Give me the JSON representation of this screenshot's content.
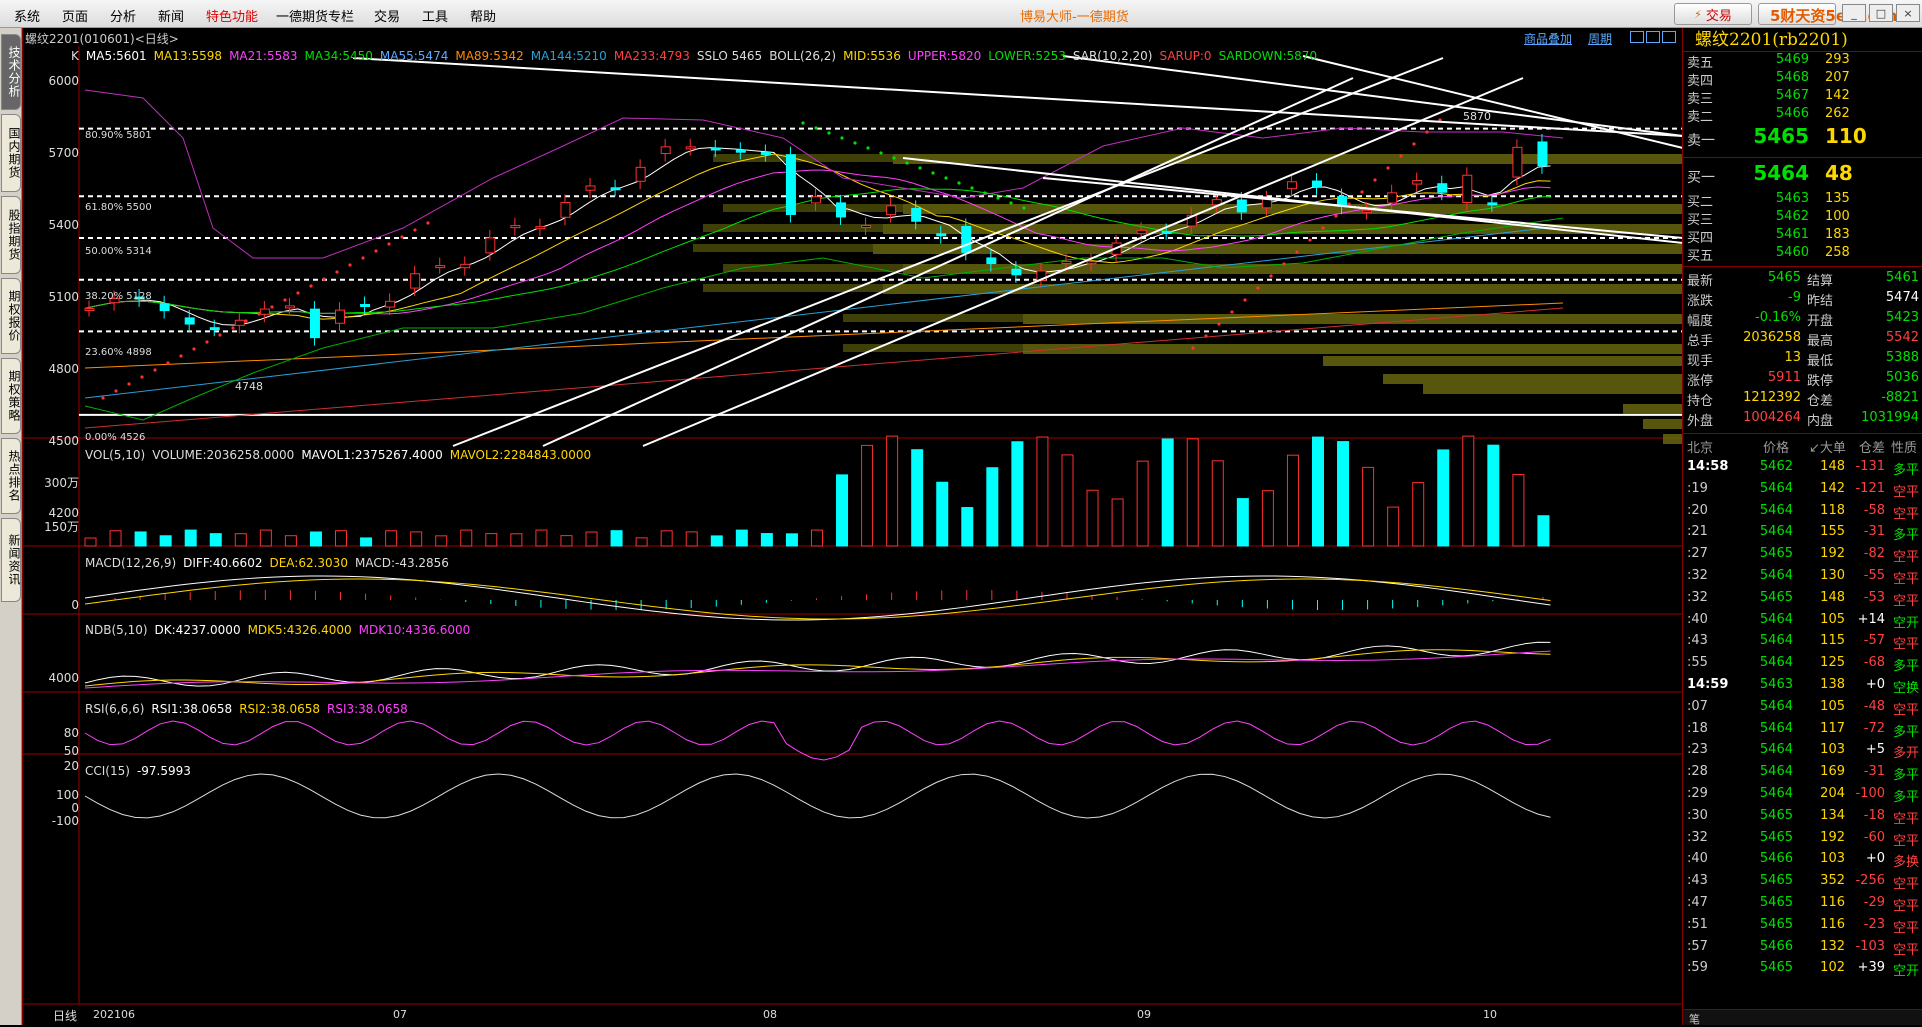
{
  "menu": [
    "系统",
    "页面",
    "分析",
    "新闻",
    "特色功能",
    "一德期货专栏",
    "交易",
    "工具",
    "帮助"
  ],
  "app_title": "博易大师-一德期货",
  "trade_button": "交易",
  "watermark": "5财天资5etz.com",
  "side_tabs": [
    "技术分析",
    "国内期货",
    "股指期货",
    "期权报价",
    "期权策略",
    "热点排名",
    "新闻资讯"
  ],
  "chart": {
    "header": "螺纹2201(010601)<日线>",
    "links": [
      "商品叠加",
      "周期"
    ],
    "k_line": [
      "K",
      "MA5:5601",
      "MA13:5598",
      "MA21:5583",
      "MA34:5450",
      "MA55:5474",
      "MA89:5342",
      "MA144:5210",
      "MA233:4793",
      "SSLO 5465",
      "BOLL(26,2)",
      "MID:5536",
      "UPPER:5820",
      "LOWER:5253",
      "SAR(10,2,20)",
      "SARUP:0",
      "SARDOWN:5870"
    ],
    "k_colors": [
      "#ddd",
      "#fff",
      "#ffd700",
      "#ff40ff",
      "#00e000",
      "#5aa9ff",
      "#ff8c00",
      "#2a9fd6",
      "#ff4040",
      "#ddd",
      "#ddd",
      "#ffd700",
      "#ff40ff",
      "#00e000",
      "#ddd",
      "#ff4040",
      "#00e000"
    ],
    "fib_labels": [
      "80.90% 5801",
      "61.80% 5500",
      "50.00% 5314",
      "38.20% 5128",
      "23.60% 4898",
      "0.00% 4526"
    ],
    "price_axis": [
      "6000",
      "5700",
      "5400",
      "5100",
      "4800",
      "4500",
      "4200"
    ],
    "annotations": {
      "high": "5870",
      "low": "4748"
    },
    "vol_line": [
      "VOL(5,10)",
      "VOLUME:2036258.0000",
      "MAVOL1:2375267.4000",
      "MAVOL2:2284843.0000"
    ],
    "vol_axis": [
      "300万",
      "150万"
    ],
    "macd_line": [
      "MACD(12,26,9)",
      "DIFF:40.6602",
      "DEA:62.3030",
      "MACD:-43.2856"
    ],
    "macd_axis": [
      "0"
    ],
    "ndb_line": [
      "NDB(5,10)",
      "DK:4237.0000",
      "MDK5:4326.4000",
      "MDK10:4336.6000"
    ],
    "ndb_axis": [
      "4000"
    ],
    "rsi_line": [
      "RSI(6,6,6)",
      "RSI1:38.0658",
      "RSI2:38.0658",
      "RSI3:38.0658"
    ],
    "rsi_axis": [
      "80",
      "50",
      "20"
    ],
    "cci_line": [
      "CCI(15)",
      "-97.5993"
    ],
    "cci_axis": [
      "100",
      "0",
      "-100"
    ],
    "period_label": "日线",
    "date_axis": [
      "202106",
      "07",
      "08",
      "09",
      "10"
    ]
  },
  "quote": {
    "title": "螺纹2201(rb2201)",
    "asks": [
      {
        "l": "卖五",
        "p": "5469",
        "v": "293"
      },
      {
        "l": "卖四",
        "p": "5468",
        "v": "207"
      },
      {
        "l": "卖三",
        "p": "5467",
        "v": "142"
      },
      {
        "l": "卖二",
        "p": "5466",
        "v": "262"
      }
    ],
    "ask1": {
      "l": "卖一",
      "p": "5465",
      "v": "110"
    },
    "bid1": {
      "l": "买一",
      "p": "5464",
      "v": "48"
    },
    "bids": [
      {
        "l": "买二",
        "p": "5463",
        "v": "135"
      },
      {
        "l": "买三",
        "p": "5462",
        "v": "100"
      },
      {
        "l": "买四",
        "p": "5461",
        "v": "183"
      },
      {
        "l": "买五",
        "p": "5460",
        "v": "258"
      }
    ],
    "info": [
      {
        "l1": "最新",
        "v1": "5465",
        "c1": "g",
        "l2": "结算",
        "v2": "5461",
        "c2": "g"
      },
      {
        "l1": "涨跌",
        "v1": "-9",
        "c1": "g",
        "l2": "昨结",
        "v2": "5474",
        "c2": "w"
      },
      {
        "l1": "幅度",
        "v1": "-0.16%",
        "c1": "g",
        "l2": "开盘",
        "v2": "5423",
        "c2": "g"
      },
      {
        "l1": "总手",
        "v1": "2036258",
        "c1": "y",
        "l2": "最高",
        "v2": "5542",
        "c2": "r"
      },
      {
        "l1": "现手",
        "v1": "13",
        "c1": "y",
        "l2": "最低",
        "v2": "5388",
        "c2": "g"
      },
      {
        "l1": "涨停",
        "v1": "5911",
        "c1": "r",
        "l2": "跌停",
        "v2": "5036",
        "c2": "g"
      },
      {
        "l1": "持仓",
        "v1": "1212392",
        "c1": "y",
        "l2": "仓差",
        "v2": "-8821",
        "c2": "g"
      },
      {
        "l1": "外盘",
        "v1": "1004264",
        "c1": "r",
        "l2": "内盘",
        "v2": "1031994",
        "c2": "g"
      }
    ],
    "tick_header": [
      "北京",
      "价格",
      "↙大单",
      "仓差",
      "性质"
    ],
    "ticks": [
      {
        "t": "14:58",
        "p": "5462",
        "v": "148",
        "o": "-131",
        "n": "多平",
        "c": "g",
        "nc": "g",
        "bold": true
      },
      {
        "t": ":19",
        "p": "5464",
        "v": "142",
        "o": "-121",
        "n": "空平",
        "c": "g",
        "nc": "r"
      },
      {
        "t": ":20",
        "p": "5464",
        "v": "118",
        "o": "-58",
        "n": "空平",
        "c": "g",
        "nc": "r"
      },
      {
        "t": ":21",
        "p": "5464",
        "v": "155",
        "o": "-31",
        "n": "多平",
        "c": "g",
        "nc": "g"
      },
      {
        "t": ":27",
        "p": "5465",
        "v": "192",
        "o": "-82",
        "n": "空平",
        "c": "g",
        "nc": "r"
      },
      {
        "t": ":32",
        "p": "5464",
        "v": "130",
        "o": "-55",
        "n": "空平",
        "c": "g",
        "nc": "r"
      },
      {
        "t": ":32",
        "p": "5465",
        "v": "148",
        "o": "-53",
        "n": "空平",
        "c": "g",
        "nc": "r"
      },
      {
        "t": ":40",
        "p": "5464",
        "v": "105",
        "o": "+14",
        "n": "空开",
        "c": "g",
        "nc": "g"
      },
      {
        "t": ":43",
        "p": "5464",
        "v": "115",
        "o": "-57",
        "n": "空平",
        "c": "g",
        "nc": "r"
      },
      {
        "t": ":55",
        "p": "5464",
        "v": "125",
        "o": "-68",
        "n": "多平",
        "c": "g",
        "nc": "g"
      },
      {
        "t": "14:59",
        "p": "5463",
        "v": "138",
        "o": "+0",
        "n": "空换",
        "c": "g",
        "nc": "g",
        "bold": true
      },
      {
        "t": ":07",
        "p": "5464",
        "v": "105",
        "o": "-48",
        "n": "空平",
        "c": "g",
        "nc": "r"
      },
      {
        "t": ":18",
        "p": "5464",
        "v": "117",
        "o": "-72",
        "n": "多平",
        "c": "g",
        "nc": "g"
      },
      {
        "t": ":23",
        "p": "5464",
        "v": "103",
        "o": "+5",
        "n": "多开",
        "c": "g",
        "nc": "r"
      },
      {
        "t": ":28",
        "p": "5464",
        "v": "169",
        "o": "-31",
        "n": "多平",
        "c": "g",
        "nc": "g"
      },
      {
        "t": ":29",
        "p": "5464",
        "v": "204",
        "o": "-100",
        "n": "多平",
        "c": "g",
        "nc": "g"
      },
      {
        "t": ":30",
        "p": "5465",
        "v": "134",
        "o": "-18",
        "n": "空平",
        "c": "g",
        "nc": "r"
      },
      {
        "t": ":32",
        "p": "5465",
        "v": "192",
        "o": "-60",
        "n": "空平",
        "c": "g",
        "nc": "r"
      },
      {
        "t": ":40",
        "p": "5466",
        "v": "103",
        "o": "+0",
        "n": "多换",
        "c": "g",
        "nc": "r"
      },
      {
        "t": ":43",
        "p": "5465",
        "v": "352",
        "o": "-256",
        "n": "空平",
        "c": "g",
        "nc": "r"
      },
      {
        "t": ":47",
        "p": "5465",
        "v": "116",
        "o": "-29",
        "n": "空平",
        "c": "g",
        "nc": "r"
      },
      {
        "t": ":51",
        "p": "5465",
        "v": "116",
        "o": "-23",
        "n": "空平",
        "c": "g",
        "nc": "r"
      },
      {
        "t": ":57",
        "p": "5466",
        "v": "132",
        "o": "-103",
        "n": "空平",
        "c": "g",
        "nc": "r"
      },
      {
        "t": ":59",
        "p": "5465",
        "v": "102",
        "o": "+39",
        "n": "空开",
        "c": "g",
        "nc": "g"
      }
    ],
    "footer": "笔"
  }
}
